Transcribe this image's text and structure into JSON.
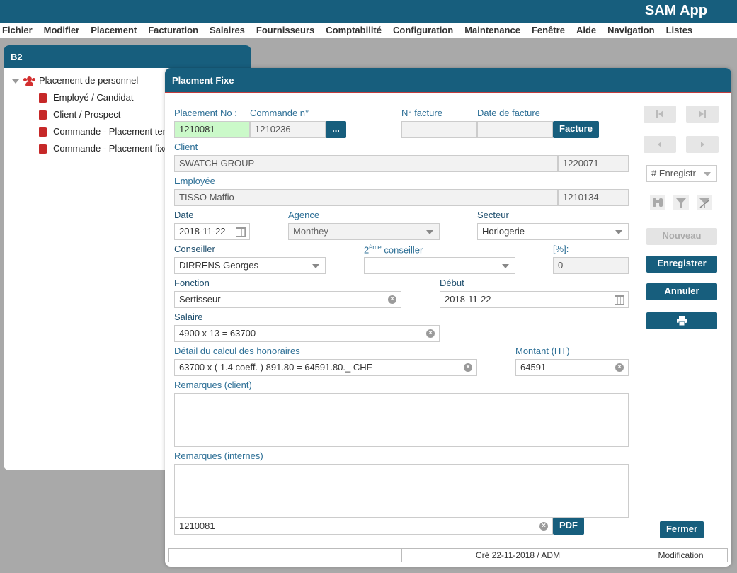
{
  "app": {
    "title": "SAM App"
  },
  "menu": [
    "Fichier",
    "Modifier",
    "Placement",
    "Facturation",
    "Salaires",
    "Fournisseurs",
    "Comptabilité",
    "Configuration",
    "Maintenance",
    "Fenêtre",
    "Aide",
    "Navigation",
    "Listes"
  ],
  "tree_panel": {
    "title": "B2",
    "root": "Placement de personnel",
    "items": [
      "Employé / Candidat",
      "Client / Prospect",
      "Commande - Placement temporaire",
      "Commande - Placement fixe"
    ]
  },
  "dialog": {
    "title": "Placment Fixe",
    "labels": {
      "placement_no": "Placement No :",
      "commande_no": "Commande n°",
      "facture_no": "N° facture",
      "facture_date": "Date de facture",
      "client": "Client",
      "employee": "Employée",
      "date": "Date",
      "agence": "Agence",
      "secteur": "Secteur",
      "conseiller": "Conseiller",
      "conseiller2_num": "2",
      "conseiller2_sup": "ème",
      "conseiller2_text": " conseiller",
      "pct": "[%]:",
      "fonction": "Fonction",
      "debut": "Début",
      "salaire": "Salaire",
      "detail": "Détail du calcul des honoraires",
      "montant": "Montant (HT)",
      "rem_client": "Remarques (client)",
      "rem_internes": "Remarques (internes)"
    },
    "values": {
      "placement_no": "1210081",
      "commande_no": "1210236",
      "facture_no": "",
      "facture_date": "",
      "client_name": "SWATCH GROUP",
      "client_id": "1220071",
      "employee_name": "TISSO Maffio",
      "employee_id": "1210134",
      "date": "2018-11-22",
      "agence": "Monthey",
      "secteur": "Horlogerie",
      "conseiller": "DIRRENS Georges",
      "conseiller2": "",
      "pct": "0",
      "fonction": "Sertisseur",
      "debut": "2018-11-22",
      "salaire": "4900 x 13 = 63700",
      "detail": "63700 x  ( 1.4 coeff. ) 891.80 = 64591.80._ CHF",
      "montant": "64591",
      "rem_client": "",
      "rem_internes": "",
      "pdf_ref": "1210081"
    },
    "buttons": {
      "browse": "...",
      "facture": "Facture",
      "pdf": "PDF",
      "nouveau": "Nouveau",
      "enregistrer": "Enregistrer",
      "annuler": "Annuler",
      "fermer": "Fermer"
    },
    "record_select": "# Enregistr",
    "status": {
      "left": "",
      "center": "Cré 22-11-2018 / ADM",
      "right": "Modification"
    }
  },
  "colors": {
    "header": "#175e7d",
    "accent_line": "#c23d3d",
    "label": "#2d6f96",
    "highlight": "#cbf9c9"
  }
}
